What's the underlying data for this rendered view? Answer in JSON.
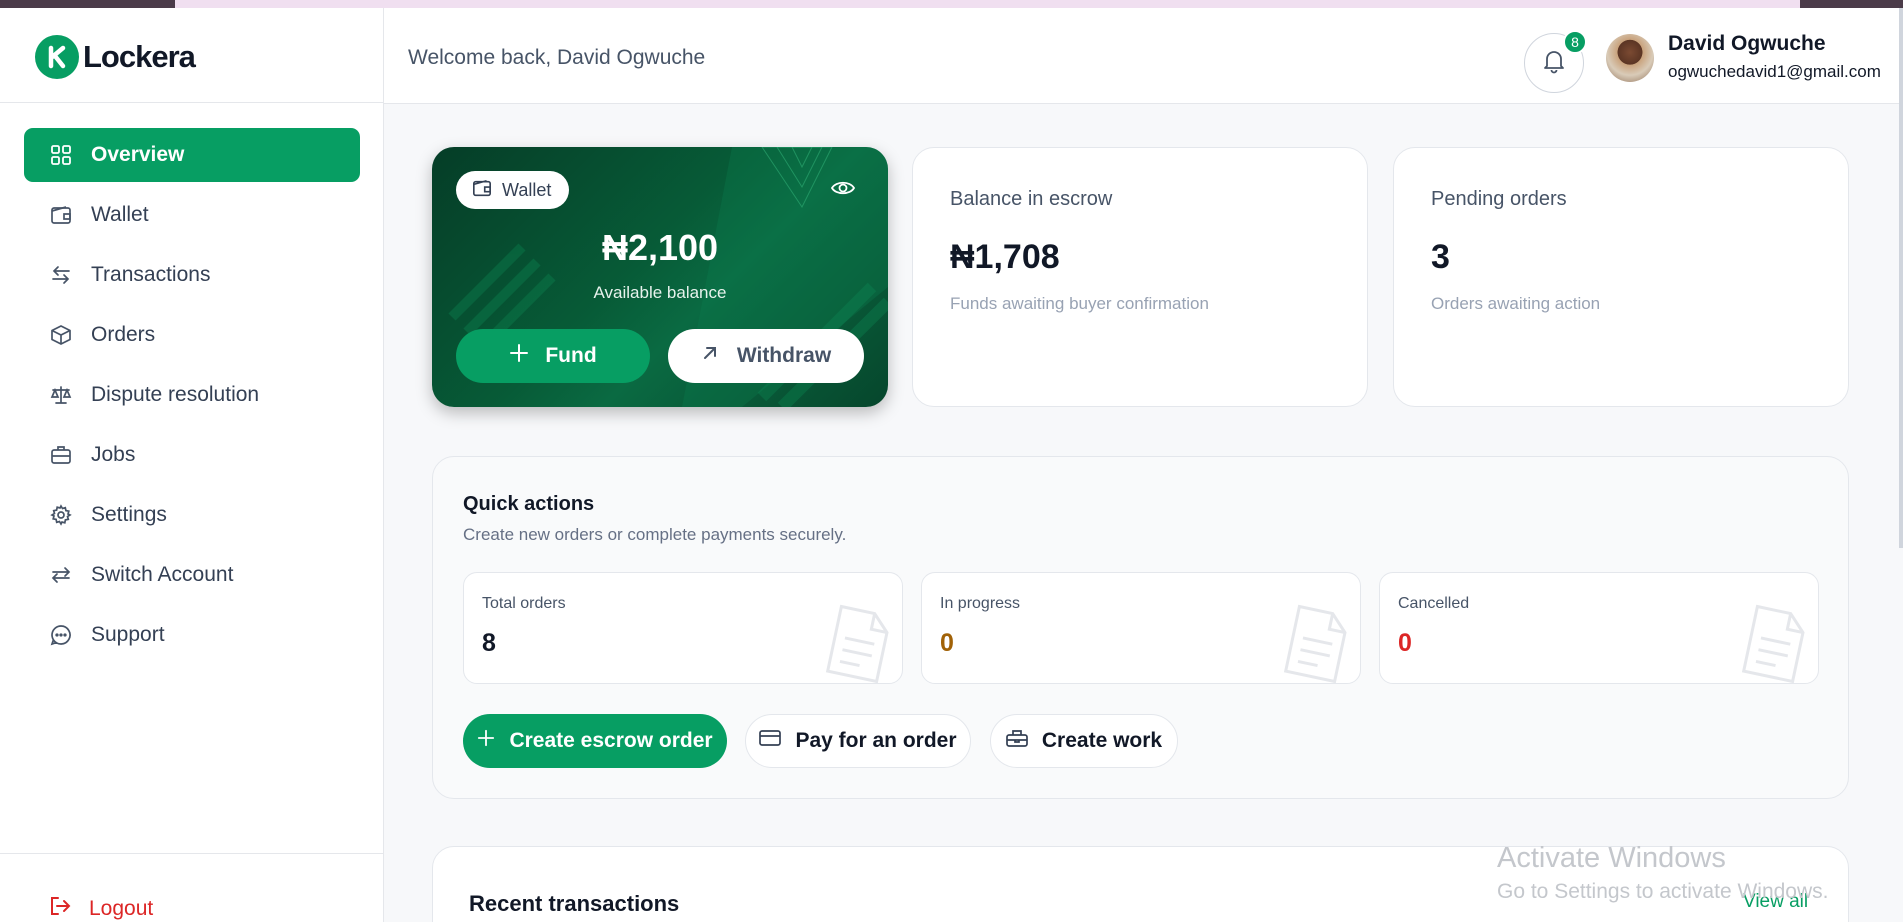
{
  "app": {
    "name": "Lockera"
  },
  "header": {
    "welcome": "Welcome back, David Ogwuche",
    "notification_count": "8",
    "user_name": "David Ogwuche",
    "user_email": "ogwuchedavid1@gmail.com"
  },
  "sidebar": {
    "items": [
      {
        "label": "Overview",
        "icon": "grid-icon",
        "active": true
      },
      {
        "label": "Wallet",
        "icon": "wallet-icon"
      },
      {
        "label": "Transactions",
        "icon": "arrows-exchange-icon"
      },
      {
        "label": "Orders",
        "icon": "box-icon"
      },
      {
        "label": "Dispute resolution",
        "icon": "scale-icon"
      },
      {
        "label": "Jobs",
        "icon": "briefcase-icon"
      },
      {
        "label": "Settings",
        "icon": "gear-icon"
      },
      {
        "label": "Switch Account",
        "icon": "switch-icon"
      },
      {
        "label": "Support",
        "icon": "chat-icon"
      }
    ],
    "logout": "Logout"
  },
  "wallet": {
    "pill": "Wallet",
    "amount": "₦2,100",
    "sub": "Available balance",
    "fund": "Fund",
    "withdraw": "Withdraw"
  },
  "stats": [
    {
      "label": "Balance in escrow",
      "value": "₦1,708",
      "sub": "Funds awaiting buyer confirmation"
    },
    {
      "label": "Pending orders",
      "value": "3",
      "sub": "Orders awaiting action"
    }
  ],
  "quick_actions": {
    "title": "Quick actions",
    "subtitle": "Create new orders or complete payments securely.",
    "cards": [
      {
        "label": "Total orders",
        "value": "8",
        "color": "#111827"
      },
      {
        "label": "In progress",
        "value": "0",
        "color": "#a16207"
      },
      {
        "label": "Cancelled",
        "value": "0",
        "color": "#dc2626"
      }
    ],
    "buttons": {
      "create_escrow": "Create escrow order",
      "pay_order": "Pay for an order",
      "create_work": "Create work"
    }
  },
  "recent": {
    "title": "Recent transactions",
    "view_all": "View all"
  },
  "overlay": {
    "line1": "Activate Windows",
    "line2": "Go to Settings to activate Windows."
  },
  "colors": {
    "brand": "#079e63",
    "danger": "#dc2626",
    "warning": "#a16207"
  }
}
